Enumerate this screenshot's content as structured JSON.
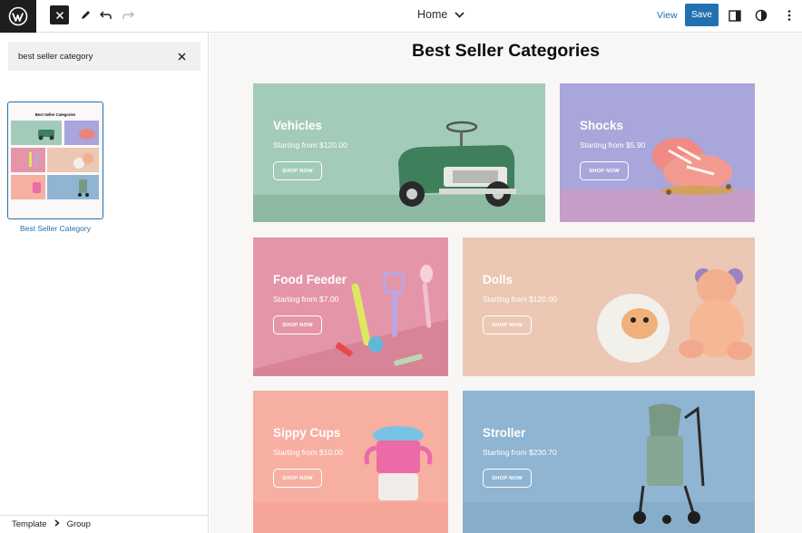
{
  "topbar": {
    "document_title": "Home",
    "view_label": "View",
    "save_label": "Save"
  },
  "sidebar": {
    "search": {
      "value": "best seller category",
      "placeholder": "Search"
    },
    "pattern": {
      "preview_title": "Best Seller Categories",
      "label": "Best Seller Category"
    },
    "breadcrumb": [
      "Template",
      "Group"
    ]
  },
  "canvas": {
    "title": "Best Seller Categories",
    "categories": [
      {
        "name": "Vehicles",
        "price": "Starting from $120.00",
        "button": "SHOP NOW",
        "bg": "#a3cbb9"
      },
      {
        "name": "Shocks",
        "price": "Starting from $5.90",
        "button": "SHOP NOW",
        "bg": "#a8a6da"
      },
      {
        "name": "Food Feeder",
        "price": "Starting from $7.00",
        "button": "SHOP NOW",
        "bg": "#e496a8"
      },
      {
        "name": "Dolls",
        "price": "Starting from $120.00",
        "button": "SHOP NOW",
        "bg": "#ebc7b4"
      },
      {
        "name": "Sippy Cups",
        "price": "Starting from $10.00",
        "button": "SHOP NOW",
        "bg": "#f7afa2"
      },
      {
        "name": "Stroller",
        "price": "Starting from $230.70",
        "button": "SHOP NOW",
        "bg": "#8fb5d2"
      }
    ]
  },
  "colors": {
    "accent": "#2271b1",
    "dark": "#1e1e1e"
  }
}
